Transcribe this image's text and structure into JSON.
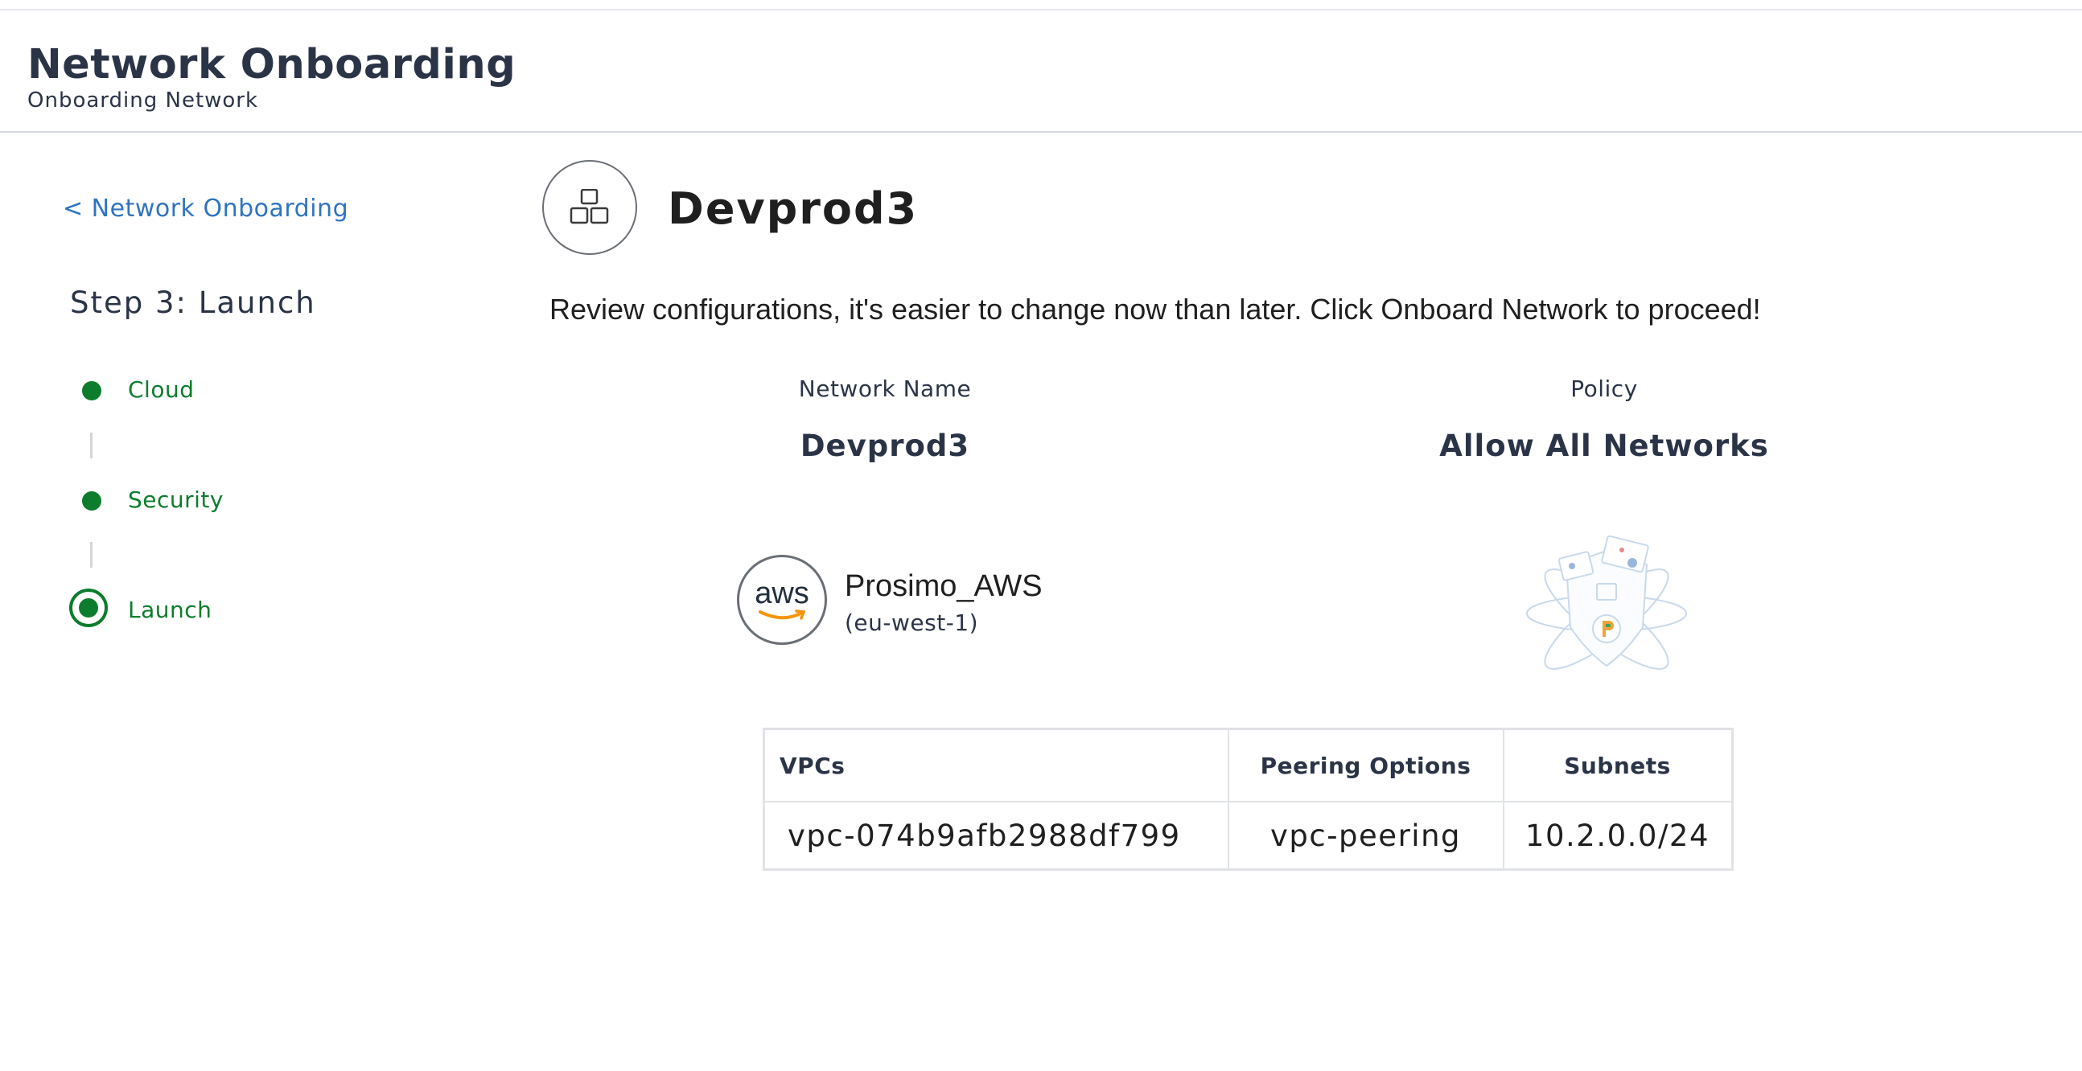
{
  "header": {
    "title": "Network Onboarding",
    "subtitle": "Onboarding Network"
  },
  "sidebar": {
    "back_link": "< Network Onboarding",
    "step_title": "Step 3: Launch",
    "steps": [
      {
        "label": "Cloud",
        "state": "completed"
      },
      {
        "label": "Security",
        "state": "completed"
      },
      {
        "label": "Launch",
        "state": "current"
      }
    ]
  },
  "main": {
    "icon": "network-blocks-icon",
    "title": "Devprod3",
    "review_text": "Review configurations, it's easier to change now than later. Click Onboard Network to proceed!",
    "network_name_label": "Network Name",
    "network_name_value": "Devprod3",
    "policy_label": "Policy",
    "policy_value": "Allow All Networks",
    "cloud": {
      "logo": "aws-logo",
      "logo_text": "aws",
      "name": "Prosimo_AWS",
      "region": "(eu-west-1)"
    },
    "policy_illustration": "shield-policy-illustration",
    "table": {
      "headers": [
        "VPCs",
        "Peering Options",
        "Subnets"
      ],
      "rows": [
        [
          "vpc-074b9afb2988df799",
          "vpc-peering",
          "10.2.0.0/24"
        ]
      ]
    }
  },
  "colors": {
    "accent_green": "#0c7d2c",
    "link_blue": "#2f74c0",
    "text_dark": "#2b3447"
  }
}
